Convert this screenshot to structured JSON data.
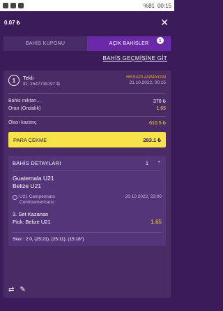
{
  "status_bar": {
    "signal": "%81",
    "time": "00:15"
  },
  "header": {
    "balance": "0.07 ₺",
    "close_icon": "close-icon"
  },
  "tabs": [
    {
      "label": "BAHİS KUPONU",
      "active": false
    },
    {
      "label": "AÇIK BAHİSLER",
      "active": true,
      "badge": "1"
    }
  ],
  "history_link": "BAHİS GEÇMİŞİNE GİT",
  "bet": {
    "number": "1",
    "type": "Tekli",
    "id": "ID: 2547739197",
    "status": "HESAPLANMAYAN",
    "date": "21.10.2022, 00:15",
    "stake_label": "Bahis miktarı...",
    "stake_value": "370 ₺",
    "odds_label": "Oran (Ondalık)",
    "odds_value": "1.65",
    "win_label": "Olası kazanç",
    "win_value": "610.5 ₺",
    "cashout_label": "PARA ÇEKME",
    "cashout_value": "283.1 ₺"
  },
  "details": {
    "title": "BAHİS DETAYLARI",
    "count": "1",
    "team1": "Guatemala U21",
    "team2": "Belize U21",
    "league": "U21 Campeonato Centroamericano",
    "event_date": "20.10.2022, 23:00",
    "market": "3. Set Kazanan",
    "pick": "Pick: Belize U21",
    "pick_odds": "1.65",
    "score": "Skor : 2:0, (25:21), (25:11), (15:18*)"
  },
  "colors": {
    "background": "#3b1b5a",
    "accent": "#6a2aa8",
    "cashout": "#f6e34a",
    "status": "#f0a630"
  }
}
